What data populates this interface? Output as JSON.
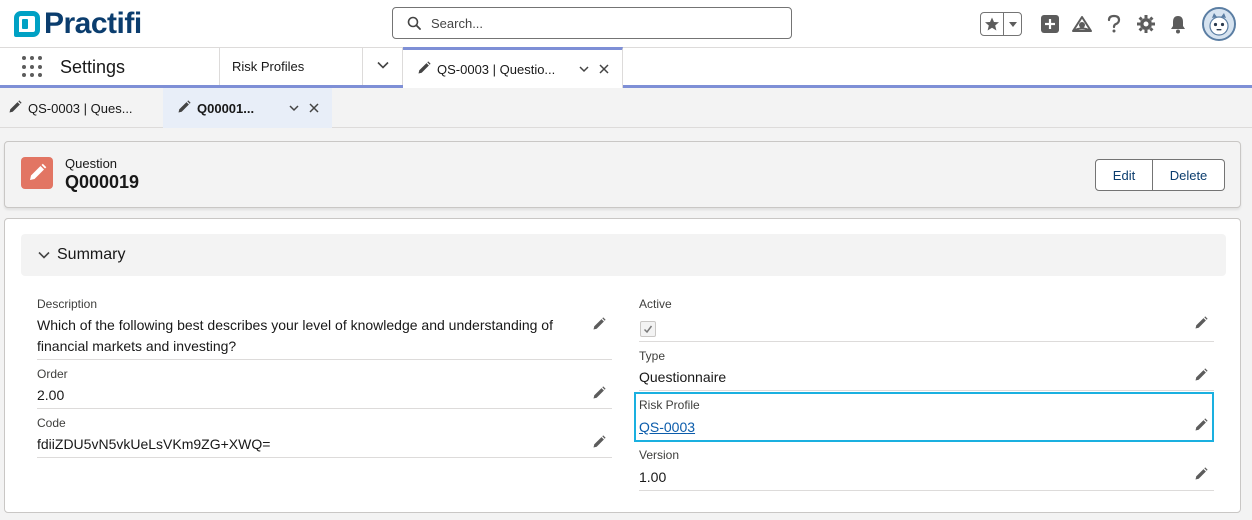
{
  "brand": {
    "name": "Practifi",
    "color": "#0b3d6e",
    "accent": "#00a1c4"
  },
  "search": {
    "placeholder": "Search..."
  },
  "header_icons": [
    "favorites-star-icon",
    "add-icon",
    "trailhead-icon",
    "help-icon",
    "setup-gear-icon",
    "notification-bell-icon",
    "user-avatar"
  ],
  "nav": {
    "app_name": "Settings",
    "items": [
      {
        "label": "Risk Profiles"
      }
    ],
    "active_tab": {
      "label": "QS-0003 | Questio..."
    }
  },
  "subtabs": [
    {
      "label": "QS-0003 | Ques..."
    },
    {
      "label": "Q00001...",
      "active": true
    }
  ],
  "record": {
    "type": "Question",
    "title": "Q000019",
    "icon_color": "#e27563",
    "actions": {
      "edit": "Edit",
      "delete": "Delete"
    }
  },
  "section": {
    "title": "Summary"
  },
  "fields": {
    "description": {
      "label": "Description",
      "value": "Which of the following best describes your level of knowledge and understanding of financial markets and investing?"
    },
    "order": {
      "label": "Order",
      "value": "2.00"
    },
    "code": {
      "label": "Code",
      "value": "fdiiZDU5vN5vkUeLsVKm9ZG+XWQ="
    },
    "active": {
      "label": "Active",
      "checked": true
    },
    "type": {
      "label": "Type",
      "value": "Questionnaire"
    },
    "risk_profile": {
      "label": "Risk Profile",
      "value": "QS-0003"
    },
    "version": {
      "label": "Version",
      "value": "1.00"
    }
  }
}
